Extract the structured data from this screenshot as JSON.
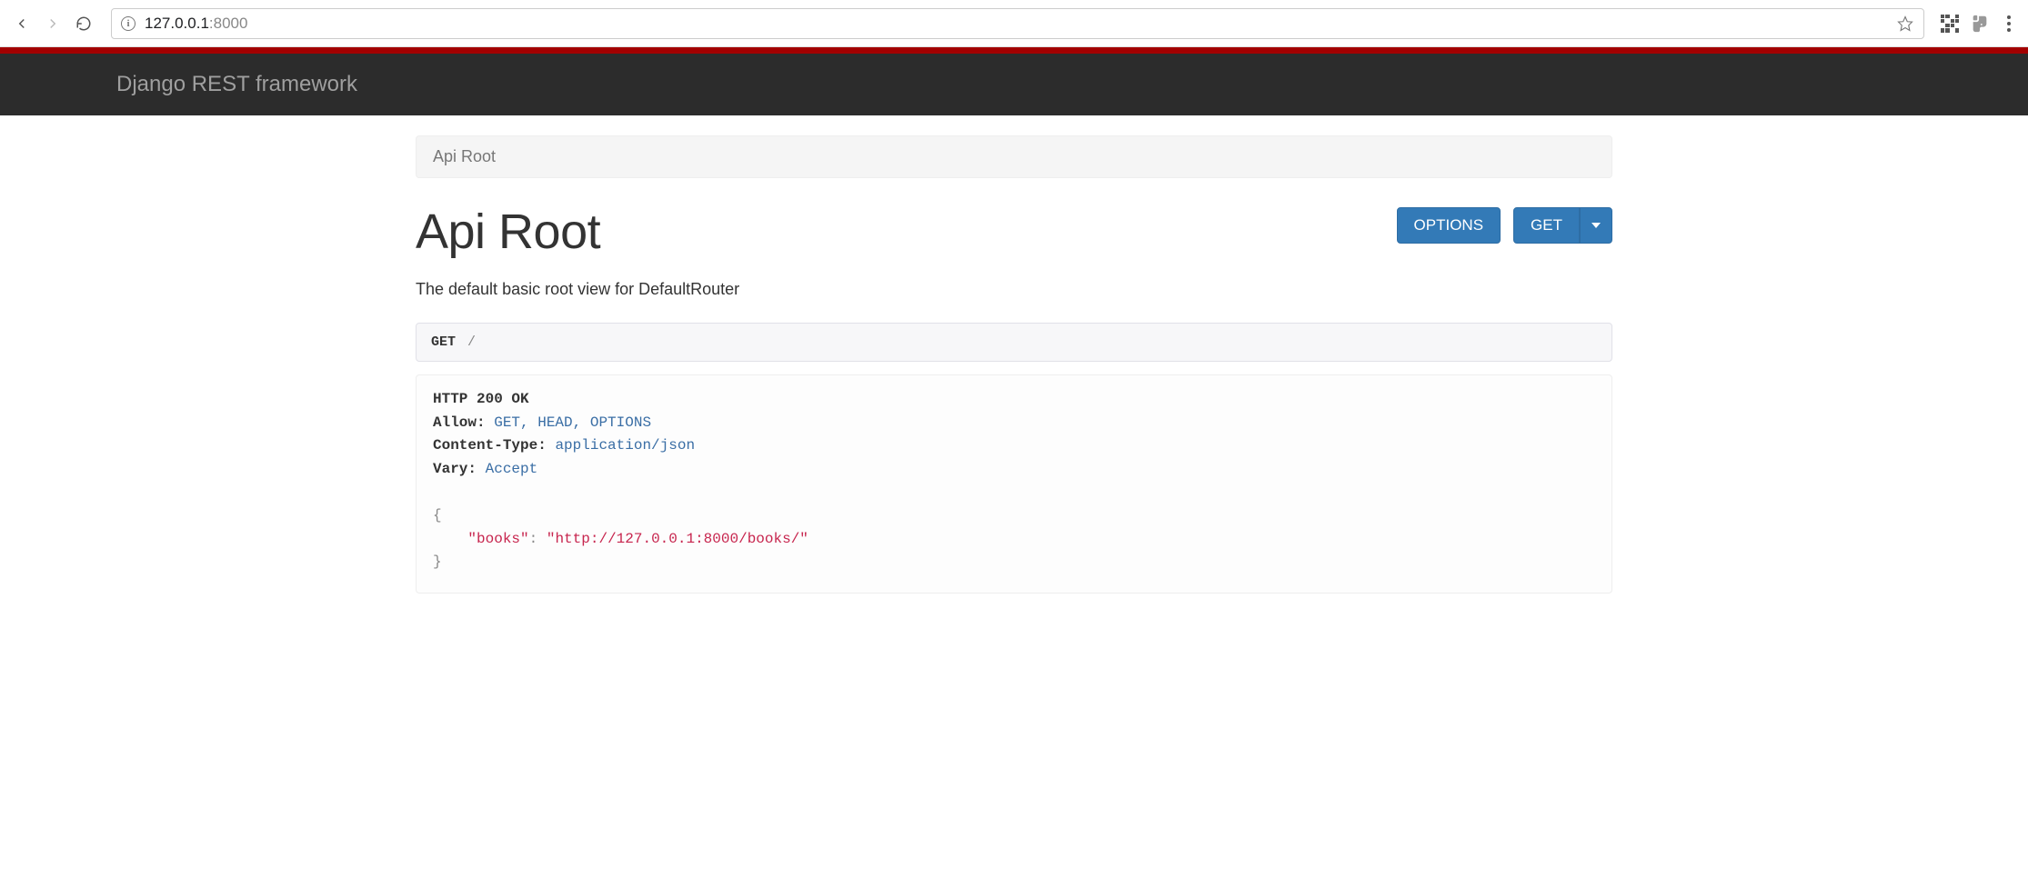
{
  "browser": {
    "url_host": "127.0.0.1",
    "url_port": ":8000"
  },
  "navbar": {
    "brand": "Django REST framework"
  },
  "breadcrumb": {
    "items": [
      "Api Root"
    ]
  },
  "header": {
    "title": "Api Root",
    "subtitle": "The default basic root view for DefaultRouter"
  },
  "buttons": {
    "options": "OPTIONS",
    "get": "GET"
  },
  "request": {
    "method": "GET",
    "path": "/"
  },
  "response": {
    "status_line": "HTTP 200 OK",
    "headers": {
      "allow_label": "Allow:",
      "allow_value": "GET, HEAD, OPTIONS",
      "content_type_label": "Content-Type:",
      "content_type_value": "application/json",
      "vary_label": "Vary:",
      "vary_value": "Accept"
    },
    "body": {
      "open_brace": "{",
      "key": "\"books\"",
      "colon": ":",
      "value_quote_open": "\"",
      "value_url": "http://127.0.0.1:8000/books/",
      "value_quote_close": "\"",
      "close_brace": "}"
    }
  }
}
